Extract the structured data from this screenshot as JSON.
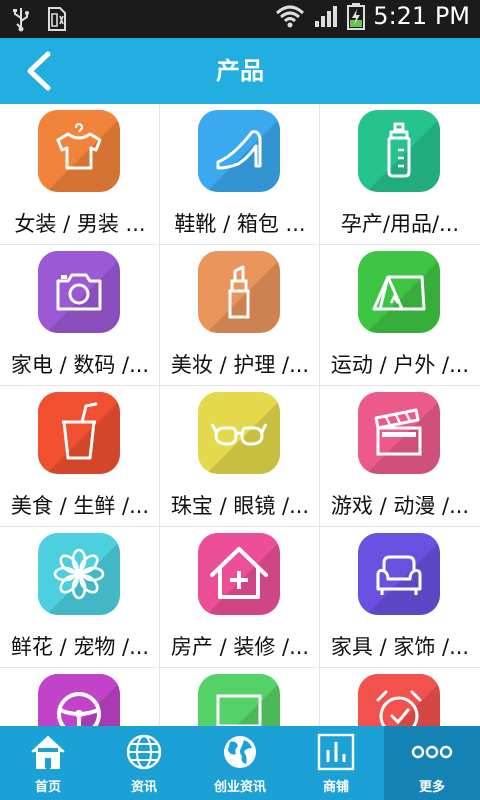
{
  "status": {
    "time": "5:21 PM"
  },
  "header": {
    "title": "产品"
  },
  "categories": [
    {
      "label": "女装 / 男装 ...",
      "color": "#f2833a",
      "icon": "tshirt-icon"
    },
    {
      "label": "鞋靴 / 箱包 ...",
      "color": "#3aa9ef",
      "icon": "high-heel-icon"
    },
    {
      "label": "孕产/用品/...",
      "color": "#27c38d",
      "icon": "baby-bottle-icon"
    },
    {
      "label": "家电 / 数码 /...",
      "color": "#9b59d6",
      "icon": "camera-icon"
    },
    {
      "label": "美妆 / 护理 /...",
      "color": "#e9955c",
      "icon": "lipstick-icon"
    },
    {
      "label": "运动 / 户外 /...",
      "color": "#3fc544",
      "icon": "tent-icon"
    },
    {
      "label": "美食 / 生鲜 /...",
      "color": "#f0502f",
      "icon": "drink-cup-icon"
    },
    {
      "label": "珠宝 / 眼镜 /...",
      "color": "#e3d94a",
      "icon": "glasses-icon"
    },
    {
      "label": "游戏 / 动漫 /...",
      "color": "#ec5a8c",
      "icon": "clapperboard-icon"
    },
    {
      "label": "鲜花 / 宠物 /...",
      "color": "#4cd0e0",
      "icon": "flower-icon"
    },
    {
      "label": "房产 / 装修 /...",
      "color": "#ec4f97",
      "icon": "house-icon"
    },
    {
      "label": "家具 / 家饰 /...",
      "color": "#6a51e2",
      "icon": "sofa-icon"
    },
    {
      "color": "#c043c9",
      "icon": "steering-wheel-icon"
    },
    {
      "color": "#55d267",
      "icon": "monitor-icon"
    },
    {
      "color": "#f2514e",
      "icon": "alarm-clock-icon"
    }
  ],
  "tabs": [
    {
      "label": "首页",
      "icon": "home-icon"
    },
    {
      "label": "资讯",
      "icon": "globe-icon"
    },
    {
      "label": "创业资讯",
      "icon": "earth-icon"
    },
    {
      "label": "商铺",
      "icon": "chart-icon"
    },
    {
      "label": "更多",
      "icon": "more-icon"
    }
  ]
}
